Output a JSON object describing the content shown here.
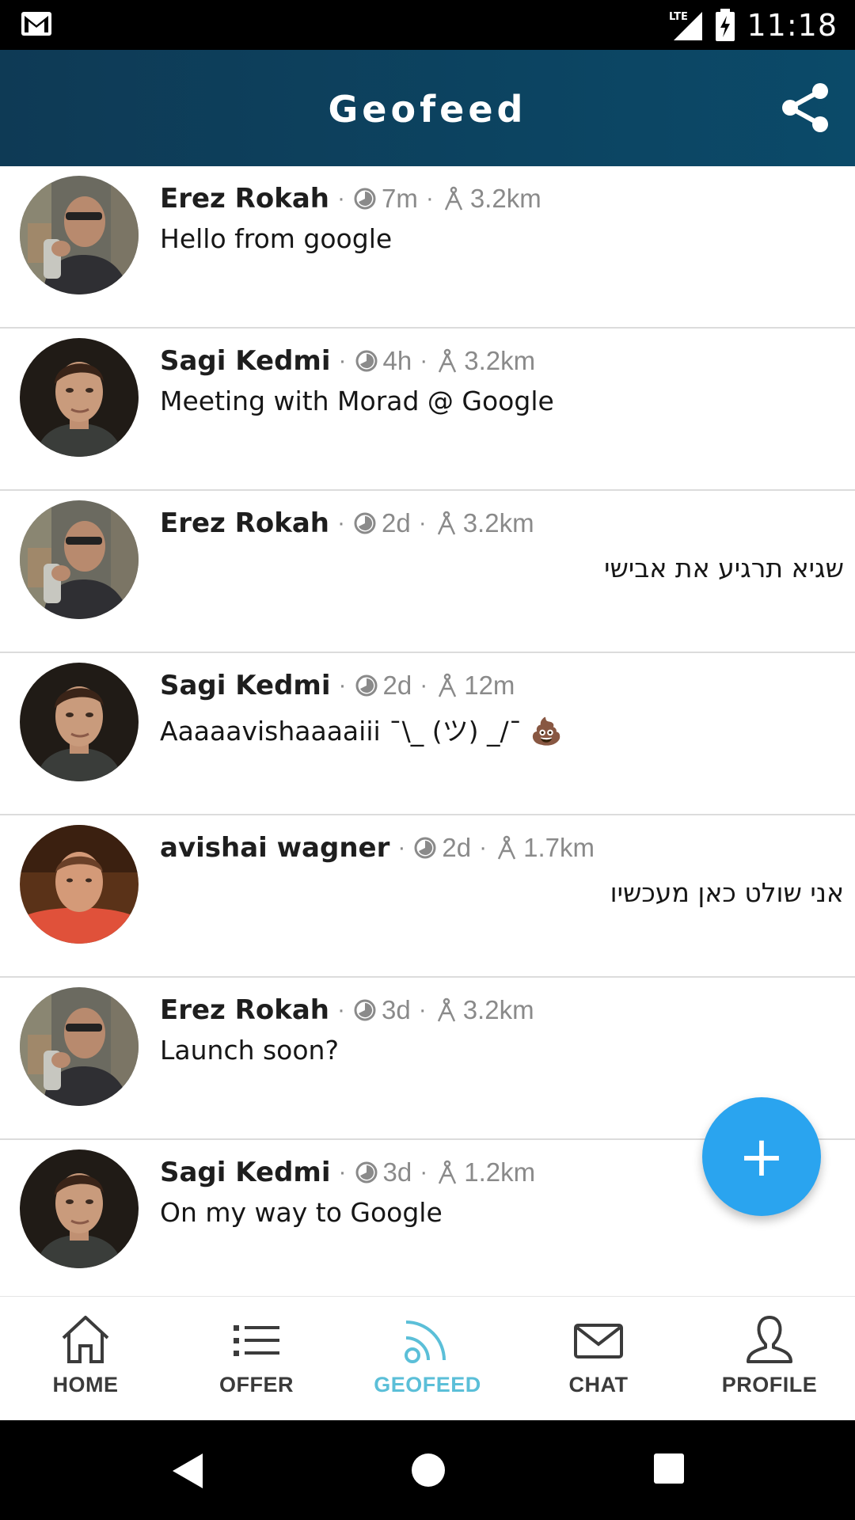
{
  "status_bar": {
    "time": "11:18",
    "network": "LTE",
    "icons": [
      "gmail-icon",
      "lte-signal-icon",
      "battery-charging-icon"
    ]
  },
  "app_bar": {
    "title": "Geofeed",
    "share_icon": "share-icon"
  },
  "feed": {
    "posts": [
      {
        "author": "Erez Rokah",
        "time": "7m",
        "distance": "3.2km",
        "message": "Hello from google",
        "rtl": false,
        "avatar": "erez"
      },
      {
        "author": "Sagi Kedmi",
        "time": "4h",
        "distance": "3.2km",
        "message": "Meeting with Morad @ Google",
        "rtl": false,
        "avatar": "sagi"
      },
      {
        "author": "Erez Rokah",
        "time": "2d",
        "distance": "3.2km",
        "message": "שגיא תרגיע את אבישי",
        "rtl": true,
        "avatar": "erez"
      },
      {
        "author": "Sagi Kedmi",
        "time": "2d",
        "distance": "12m",
        "message": "Aaaaavishaaaaiii ¯\\_ (ツ) _/¯ 💩",
        "rtl": false,
        "avatar": "sagi"
      },
      {
        "author": "avishai wagner",
        "time": "2d",
        "distance": "1.7km",
        "message": "אני שולט כאן מעכשיו",
        "rtl": true,
        "avatar": "avishai"
      },
      {
        "author": "Erez Rokah",
        "time": "3d",
        "distance": "3.2km",
        "message": "Launch soon?",
        "rtl": false,
        "avatar": "erez"
      },
      {
        "author": "Sagi Kedmi",
        "time": "3d",
        "distance": "1.2km",
        "message": "On my way to Google",
        "rtl": false,
        "avatar": "sagi"
      }
    ]
  },
  "fab": {
    "label": "+",
    "icon": "add-icon",
    "color": "#2aa4ef"
  },
  "bottom_nav": {
    "items": [
      {
        "label": "HOME",
        "icon": "home-icon",
        "active": false
      },
      {
        "label": "OFFER",
        "icon": "list-icon",
        "active": false
      },
      {
        "label": "GEOFEED",
        "icon": "geofeed-icon",
        "active": true
      },
      {
        "label": "CHAT",
        "icon": "mail-icon",
        "active": false
      },
      {
        "label": "PROFILE",
        "icon": "person-icon",
        "active": false
      }
    ],
    "active_color": "#5bbfd8"
  },
  "system_nav": {
    "icons": [
      "back-icon",
      "home-circle-icon",
      "recents-icon"
    ]
  },
  "colors": {
    "app_bar": "#0b4a69",
    "divider": "#dcdcdc",
    "meta_text": "#8a8a8a"
  }
}
